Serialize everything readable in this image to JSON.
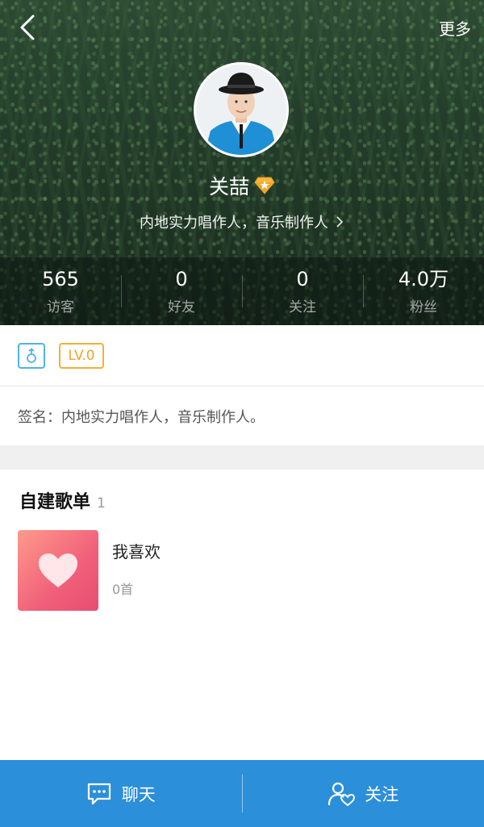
{
  "header": {
    "more_label": "更多",
    "name": "关喆",
    "bio": "内地实力唱作人，音乐制作人",
    "stats": [
      {
        "value": "565",
        "label": "访客"
      },
      {
        "value": "0",
        "label": "好友"
      },
      {
        "value": "0",
        "label": "关注"
      },
      {
        "value": "4.0万",
        "label": "粉丝"
      }
    ]
  },
  "badges": {
    "level": "LV.0"
  },
  "signature": {
    "text": "签名：内地实力唱作人，音乐制作人。"
  },
  "playlists_section": {
    "title": "自建歌单",
    "count": "1",
    "items": [
      {
        "name": "我喜欢",
        "count": "0首"
      }
    ]
  },
  "bottom_bar": {
    "chat_label": "聊天",
    "follow_label": "关注"
  },
  "colors": {
    "accent_blue": "#2c8fd9",
    "level_orange": "#f0b23a",
    "gender_blue": "#4fb3e4",
    "playlist_pink": "#f0607a"
  }
}
